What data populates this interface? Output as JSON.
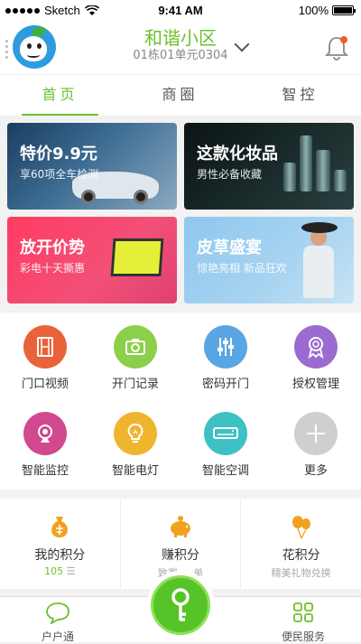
{
  "status_bar": {
    "carrier": "Sketch",
    "time": "9:41 AM",
    "battery": "100%"
  },
  "header": {
    "community_name": "和谐小区",
    "unit": "01栋01单元0304"
  },
  "tabs": [
    {
      "label": "首页",
      "active": true
    },
    {
      "label": "商圈",
      "active": false
    },
    {
      "label": "智控",
      "active": false
    }
  ],
  "banners": [
    {
      "title": "特价9.9元",
      "subtitle": "享60项全车检测"
    },
    {
      "title": "这款化妆品",
      "subtitle": "男性必备收藏"
    },
    {
      "title": "放开价势",
      "subtitle": "彩电十天撕惠"
    },
    {
      "title": "皮草盛宴",
      "subtitle": "惊艳亮相 新品狂欢"
    }
  ],
  "functions": [
    {
      "label": "门口视频",
      "icon": "film-icon",
      "color": "#e9623a"
    },
    {
      "label": "开门记录",
      "icon": "camera-icon",
      "color": "#8ccf4a"
    },
    {
      "label": "密码开门",
      "icon": "sliders-icon",
      "color": "#5aa5e3"
    },
    {
      "label": "授权管理",
      "icon": "badge-icon",
      "color": "#9b6bd1"
    },
    {
      "label": "智能监控",
      "icon": "webcam-icon",
      "color": "#d1498f"
    },
    {
      "label": "智能电灯",
      "icon": "bulb-icon",
      "color": "#f0b52f"
    },
    {
      "label": "智能空调",
      "icon": "air-conditioner-icon",
      "color": "#3ec1c4"
    },
    {
      "label": "更多",
      "icon": "plus-icon",
      "color": "#cfcfcf"
    }
  ],
  "points": {
    "my": {
      "label": "我的积分",
      "value": "105"
    },
    "earn": {
      "label": "赚积分",
      "subtitle": "致富 ... 单"
    },
    "spend": {
      "label": "花积分",
      "subtitle": "精美礼物兑换"
    }
  },
  "bottom_nav": {
    "left": "户户通",
    "right": "便民服务"
  },
  "colors": {
    "accent": "#6cc12c"
  }
}
